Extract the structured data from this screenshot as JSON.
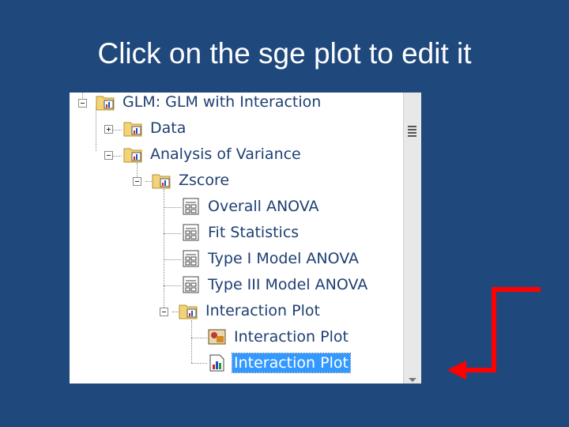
{
  "slide": {
    "title": "Click on the sge plot to edit it"
  },
  "tree": {
    "items": [
      {
        "label": "GLM:  GLM with Interaction",
        "icon": "folder-results-icon",
        "expander": "minus"
      },
      {
        "label": "Data",
        "icon": "folder-results-icon",
        "expander": "plus"
      },
      {
        "label": "Analysis of Variance",
        "icon": "folder-results-icon",
        "expander": "minus"
      },
      {
        "label": "Zscore",
        "icon": "folder-results-icon",
        "expander": "minus"
      },
      {
        "label": "Overall ANOVA",
        "icon": "table-output-icon",
        "expander": "none"
      },
      {
        "label": "Fit Statistics",
        "icon": "table-output-icon",
        "expander": "none"
      },
      {
        "label": "Type I Model ANOVA",
        "icon": "table-output-icon",
        "expander": "none"
      },
      {
        "label": "Type III Model ANOVA",
        "icon": "table-output-icon",
        "expander": "none"
      },
      {
        "label": "Interaction Plot",
        "icon": "folder-results-icon",
        "expander": "minus"
      },
      {
        "label": "Interaction Plot",
        "icon": "graph-image-icon",
        "expander": "none"
      },
      {
        "label": "Interaction Plot",
        "icon": "sge-plot-icon",
        "expander": "none",
        "selected": true
      }
    ]
  },
  "colors": {
    "background": "#1f497d",
    "selection": "#3399ff",
    "arrow": "#ff0000"
  }
}
